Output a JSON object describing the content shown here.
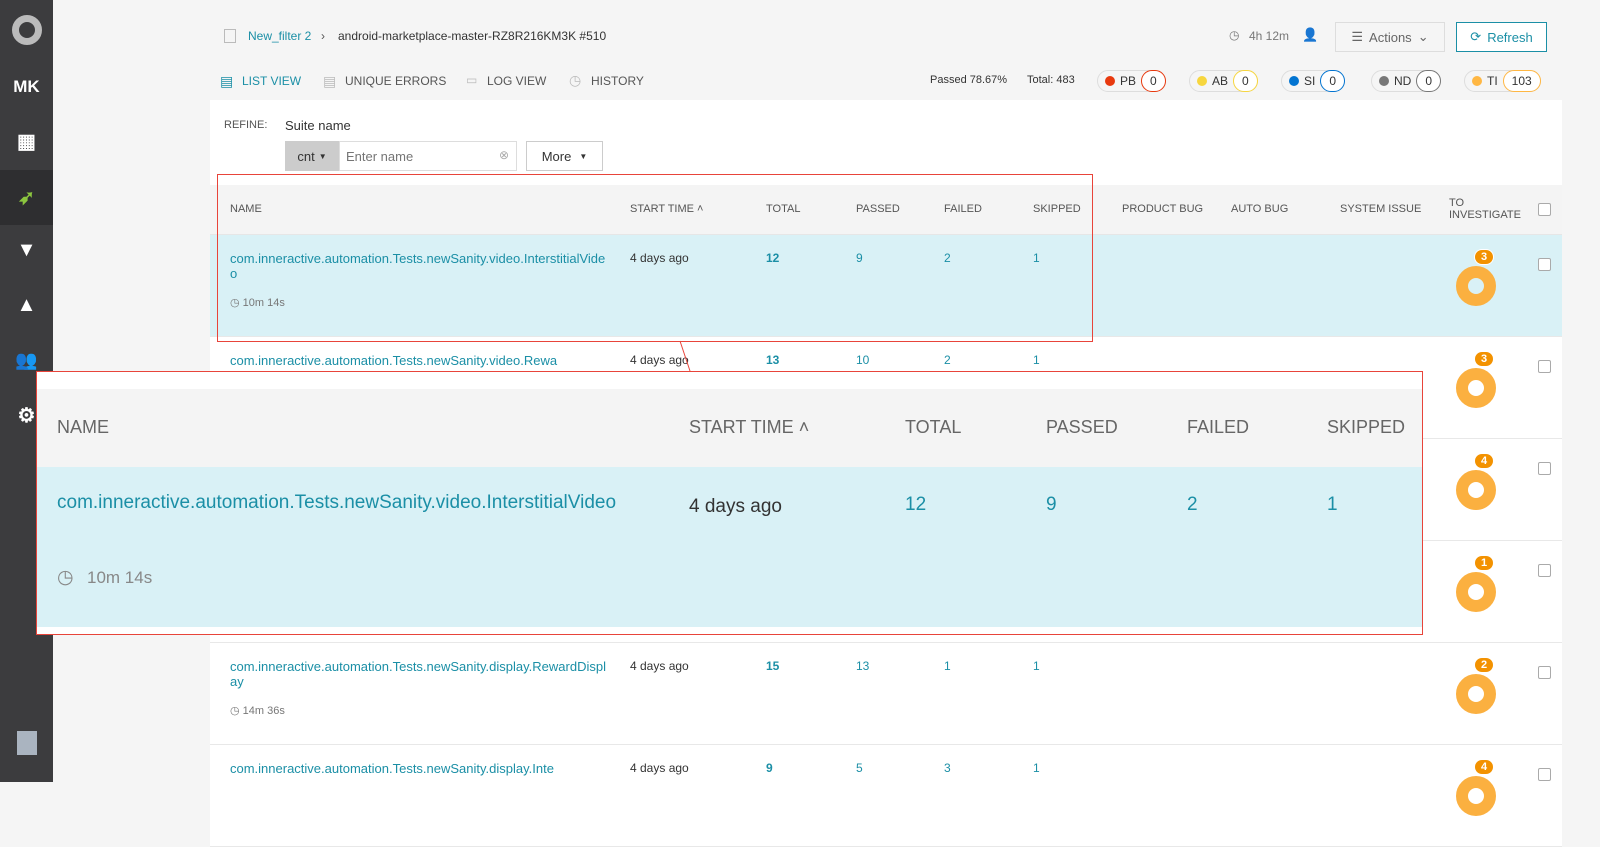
{
  "sidebar": {
    "user_initials": "MK",
    "items": [
      "logo",
      "dashboards",
      "launches",
      "filters",
      "debug",
      "members",
      "settings"
    ]
  },
  "breadcrumb": {
    "filter": "New_filter 2",
    "launch": "android-marketplace-master-RZ8R216KM3K #510"
  },
  "header": {
    "duration": "4h 12m",
    "actions_label": "Actions",
    "refresh_label": "Refresh"
  },
  "tabs": [
    "LIST VIEW",
    "UNIQUE ERRORS",
    "LOG VIEW",
    "HISTORY"
  ],
  "stats": {
    "passed": "Passed 78.67%",
    "total": "Total: 483"
  },
  "defect_badges": [
    {
      "label": "PB",
      "count": "0",
      "color": "#e8390e"
    },
    {
      "label": "AB",
      "count": "0",
      "color": "#f7d63e"
    },
    {
      "label": "SI",
      "count": "0",
      "color": "#0274d1"
    },
    {
      "label": "ND",
      "count": "0",
      "color": "#777777"
    },
    {
      "label": "TI",
      "count": "103",
      "color": "#ffb743"
    }
  ],
  "refine": {
    "label": "REFINE:",
    "field": "Suite name",
    "operator": "cnt",
    "placeholder": "Enter name",
    "more": "More"
  },
  "columns": [
    "NAME",
    "START TIME",
    "TOTAL",
    "PASSED",
    "FAILED",
    "SKIPPED",
    "PRODUCT BUG",
    "AUTO BUG",
    "SYSTEM ISSUE",
    "TO INVESTIGATE"
  ],
  "rows": [
    {
      "name": "com.inneractive.automation.Tests.newSanity.video.InterstitialVideo",
      "start": "4 days ago",
      "total": "12",
      "passed": "9",
      "failed": "2",
      "skipped": "1",
      "duration": "10m 14s",
      "to_investigate": "3"
    },
    {
      "name": "com.inneractive.automation.Tests.newSanity.video.Rewa",
      "start": "4 days ago",
      "total": "13",
      "passed": "10",
      "failed": "2",
      "skipped": "1",
      "duration": "",
      "to_investigate": "3"
    },
    {
      "name": "",
      "start": "",
      "total": "",
      "passed": "",
      "failed": "",
      "skipped": "",
      "duration": "",
      "to_investigate": "4"
    },
    {
      "name": "",
      "start": "",
      "total": "",
      "passed": "",
      "failed": "",
      "skipped": "",
      "duration": "",
      "to_investigate": "1"
    },
    {
      "name": "com.inneractive.automation.Tests.newSanity.display.RewardDisplay",
      "start": "4 days ago",
      "total": "15",
      "passed": "13",
      "failed": "1",
      "skipped": "1",
      "duration": "14m 36s",
      "to_investigate": "2"
    },
    {
      "name": "com.inneractive.automation.Tests.newSanity.display.Inte",
      "start": "4 days ago",
      "total": "9",
      "passed": "5",
      "failed": "3",
      "skipped": "1",
      "duration": "",
      "to_investigate": "4"
    }
  ],
  "callout": {
    "columns": [
      "NAME",
      "START TIME",
      "TOTAL",
      "PASSED",
      "FAILED",
      "SKIPPED"
    ],
    "name": "com.inneractive.automation.Tests.newSanity.video.InterstitialVideo",
    "start": "4 days ago",
    "total": "12",
    "passed": "9",
    "failed": "2",
    "skipped": "1",
    "duration": "10m 14s"
  }
}
